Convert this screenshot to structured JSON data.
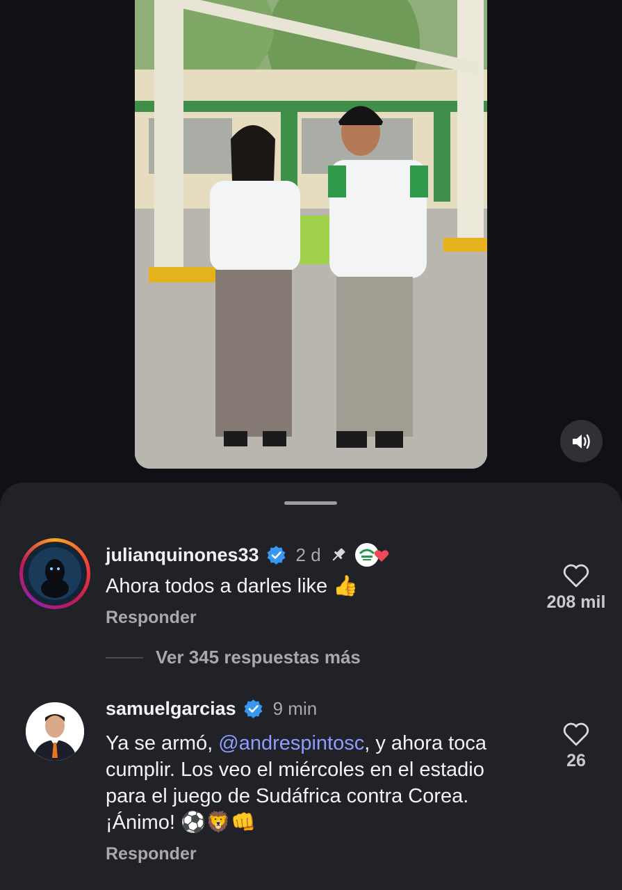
{
  "video": {
    "mute_icon": "speaker-volume-icon"
  },
  "sheet": {
    "handle_icon": "drag-handle"
  },
  "comments": [
    {
      "username": "julianquinones33",
      "verified": true,
      "time": "2 d",
      "pinned": true,
      "liked_by_creator": true,
      "text": "Ahora todos a darles like 👍",
      "reply_label": "Responder",
      "likes": "208 mil",
      "more_replies": "Ver 345 respuestas más"
    },
    {
      "username": "samuelgarcias",
      "verified": true,
      "time": "9 min",
      "text_before_mention": "Ya se armó, ",
      "mention": "@andrespintosc",
      "text_after_mention": ", y ahora toca cumplir. Los veo el miércoles en el estadio para el juego de Sudáfrica contra Corea. ¡Ánimo! ⚽🦁👊",
      "reply_label": "Responder",
      "likes": "26"
    }
  ],
  "colors": {
    "background": "#0f1117",
    "sheet": "#212228",
    "verified_badge": "#3897f0",
    "mention": "#8e9cff",
    "muted_text": "#a8a9ae",
    "heart_red": "#ed4956"
  }
}
